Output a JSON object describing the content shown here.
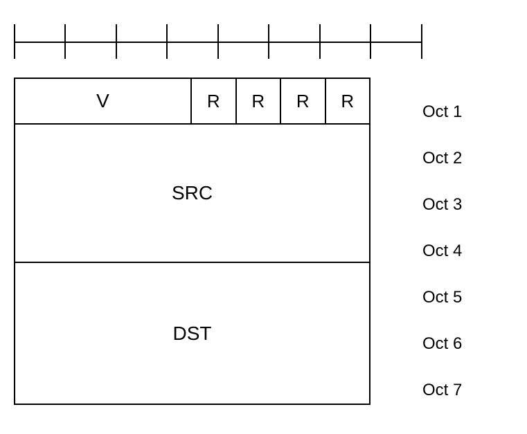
{
  "ruler": {
    "ticks": 9
  },
  "header": {
    "v_label": "V",
    "r_labels": [
      "R",
      "R",
      "R",
      "R"
    ]
  },
  "body_rows": {
    "src_label": "SRC",
    "dst_label": "DST"
  },
  "octet_labels": [
    "Oct 1",
    "Oct 2",
    "Oct 3",
    "Oct 4",
    "Oct 5",
    "Oct 6",
    "Oct 7"
  ]
}
